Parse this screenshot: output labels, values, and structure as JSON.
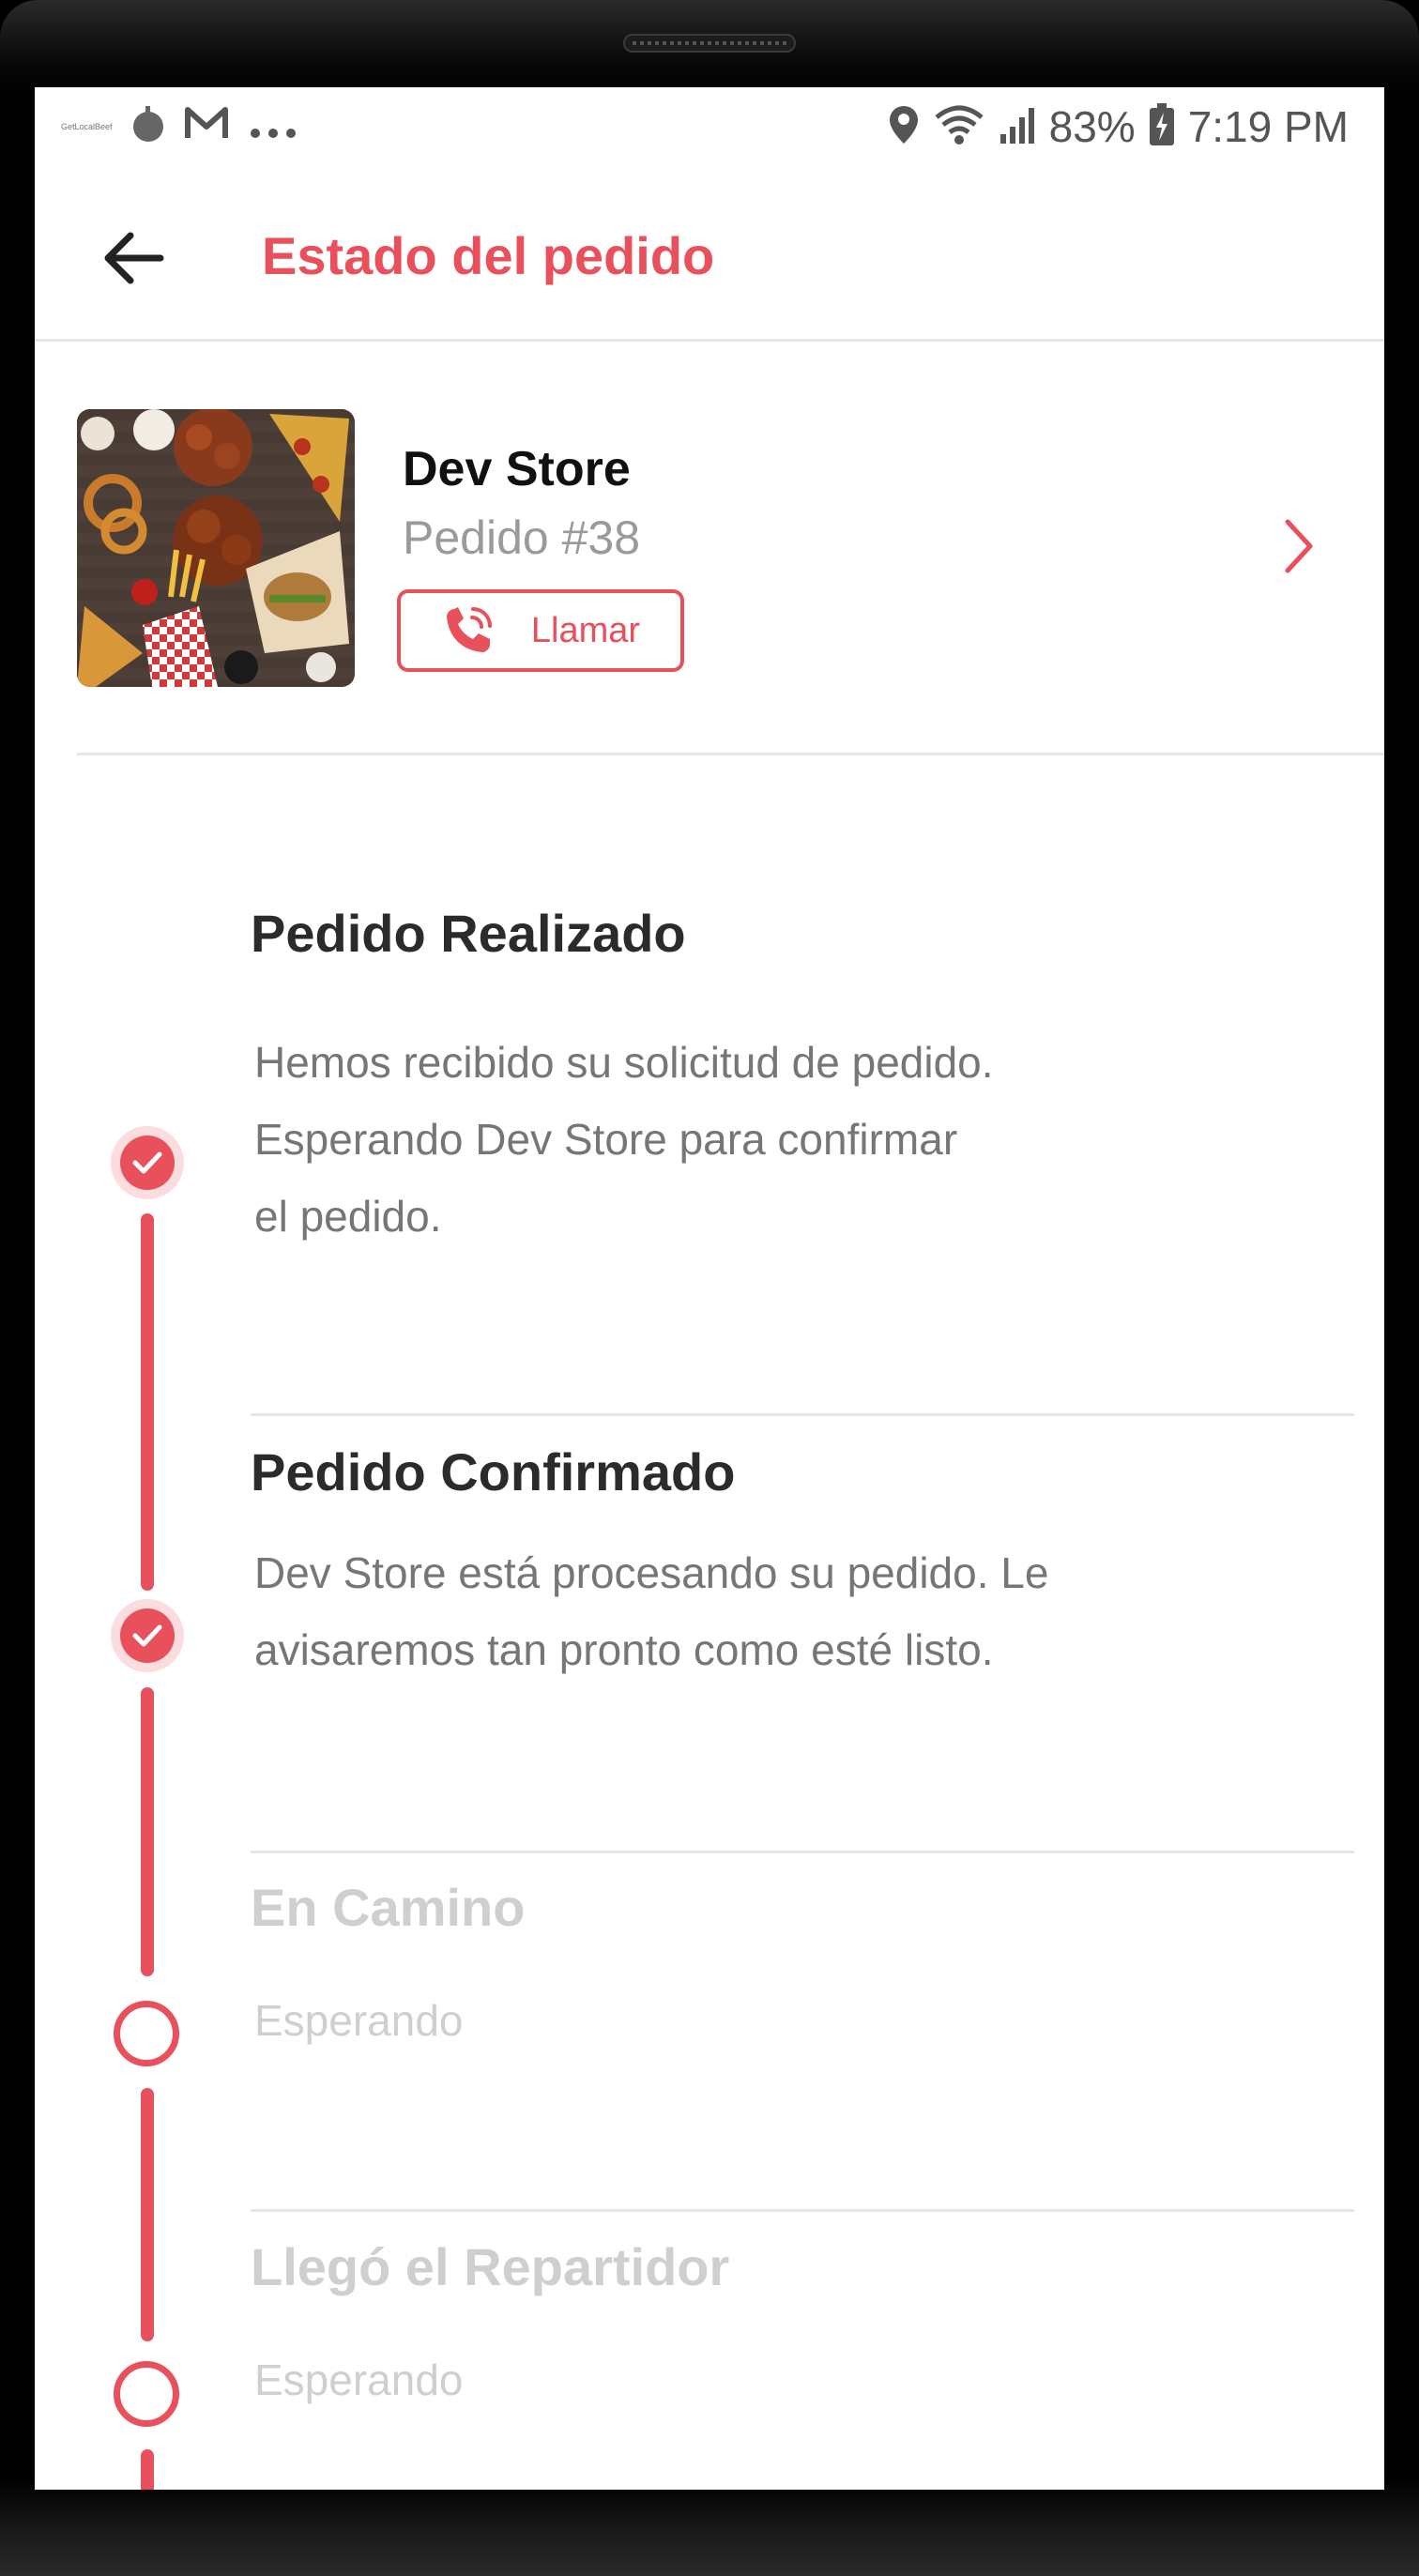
{
  "status_bar": {
    "tiny_app_text": "GetLocalBeef",
    "battery": "83%",
    "time": "7:19 PM",
    "left_icons": [
      "record-icon",
      "gmail-icon",
      "more-dots-icon"
    ],
    "right_icons": [
      "location-icon",
      "wifi-icon",
      "signal-icon",
      "battery-charging-icon"
    ]
  },
  "app_bar": {
    "title": "Estado del pedido",
    "accent_color": "#e8505b"
  },
  "store": {
    "name": "Dev Store",
    "order": "Pedido #38",
    "call_label": "Llamar"
  },
  "timeline": {
    "steps": [
      {
        "title": "Pedido Realizado",
        "lines": [
          "Hemos recibido su solicitud de pedido.",
          "Esperando Dev Store para confirmar",
          "el pedido."
        ],
        "state": "done"
      },
      {
        "title": "Pedido Confirmado",
        "lines": [
          "Dev Store está procesando su pedido. Le",
          "avisaremos tan pronto como esté listo."
        ],
        "state": "done"
      },
      {
        "title": "En Camino",
        "lines": [
          "Esperando"
        ],
        "state": "pending"
      },
      {
        "title": "Llegó el Repartidor",
        "lines": [
          "Esperando"
        ],
        "state": "pending"
      }
    ]
  }
}
